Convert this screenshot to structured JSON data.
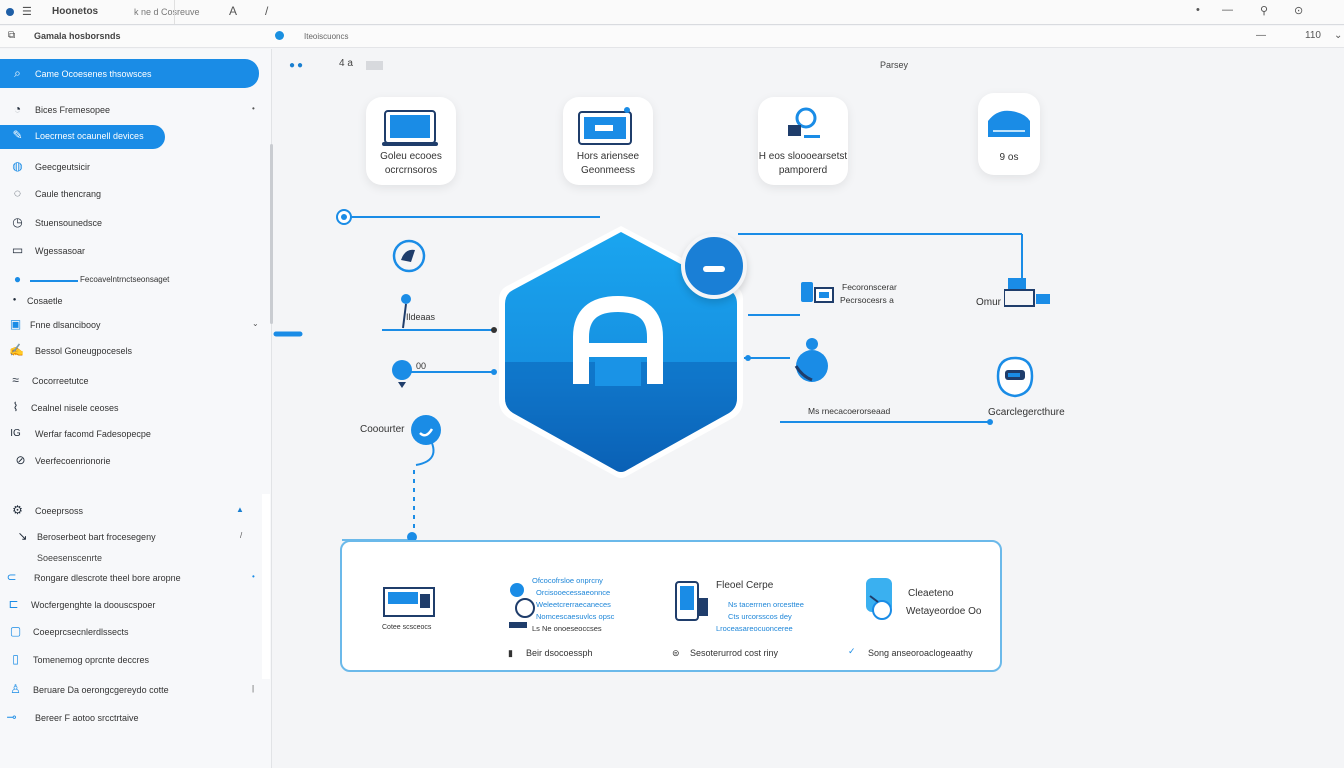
{
  "titlebar": {
    "title": "Hoonetos",
    "subtitle": "k ne d Cosreuve",
    "glyph_a": "A",
    "glyph_pen": "/",
    "buttons": [
      "•",
      "—",
      "⊙"
    ]
  },
  "toolbar": {
    "label": "Gamala hosborsnds",
    "path": "Iteoiscuoncs",
    "controls": [
      "—",
      "110",
      "⌄"
    ]
  },
  "sidebar": {
    "items": [
      {
        "icon": "search-icon",
        "label": "Came Ocoesenes thsowsces",
        "active": true
      },
      {
        "icon": "chat-icon",
        "label": "Bices Fremesopee"
      },
      {
        "icon": "edit-icon",
        "label": "Loecrnest ocaunell devices",
        "active": true
      },
      {
        "icon": "globe-icon",
        "label": "Geecgeutsicir"
      },
      {
        "icon": "notebook-icon",
        "label": "Caule thencrang"
      },
      {
        "icon": "clock-icon",
        "label": "Stuensounedsce"
      },
      {
        "icon": "chat-icon",
        "label": "Wgessasoar"
      },
      {
        "icon": "pin-icon",
        "label": "Fecoavelntrnctseonsaget"
      },
      {
        "icon": "bullet-icon",
        "label": "Cosaetle"
      },
      {
        "icon": "doc-icon",
        "label": "Fnne dlsancibooy"
      },
      {
        "icon": "edit-icon",
        "label": "Bessol Goneugpocesels"
      },
      {
        "icon": "wifi-icon",
        "label": "Cocorreetutce"
      },
      {
        "icon": "pen-icon",
        "label": "Cealnel nisele ceoses"
      },
      {
        "icon": "ip-icon",
        "label": "Werfar facomd Fadesopecpe"
      },
      {
        "icon": "tools-icon",
        "label": "Veerfecoenrionorie"
      },
      {
        "icon": "gear-icon",
        "label": "Coeeprsoss"
      },
      {
        "icon": "arrow-icon",
        "label": "Beroserbeot bart frocesegeny"
      },
      {
        "icon": "none",
        "label": "Soeesenscenrte"
      },
      {
        "icon": "link-icon",
        "label": "Rongare dlescrote theel bore aropne"
      },
      {
        "icon": "folder-icon",
        "label": "Wocfergenghte la doouscspoer"
      },
      {
        "icon": "box-icon",
        "label": "Coeeprcsecnlerdlssects"
      },
      {
        "icon": "tag-icon",
        "label": "Tomenemog oprcnte deccres"
      },
      {
        "icon": "user-icon",
        "label": "Beruare Da oerongcgereydo cotte"
      },
      {
        "icon": "link-icon",
        "label": "Bereer F aotoo srcctrtaive"
      }
    ]
  },
  "main": {
    "header": {
      "tabs": "4 a",
      "right": "Parsey"
    },
    "cards": [
      {
        "line1": "Goleu ecooes",
        "line2": "ocrcrnsoros"
      },
      {
        "line1": "Hors ariensee",
        "line2": "Geonmeess"
      },
      {
        "line1": "H eos sloooearsetst",
        "line2": "pamporerd"
      },
      {
        "line1": "9 os",
        "line2": ""
      }
    ],
    "labels": {
      "left_mid": "Ildeaas",
      "left_dd": "00",
      "left_low": "Cooourter",
      "right_1a": "Fecoronscerar",
      "right_1b": "Pecrsocesrs a",
      "right_1c": "Omur",
      "right_2": "Ms rnecacoerorseaad",
      "right_2b": "Gcarclegercthure"
    },
    "panel": {
      "item1_caption": "Cotee scsceocs",
      "item2_lines": [
        "Ofcocofrsloe onprcny",
        "Orcisooecessaeonnce",
        "Weleetcrerraecaneces",
        "Nomcescaesuvlcs opsc",
        "Ls Ne onoeseoccses"
      ],
      "item3_title": "Fleoel Cerpe",
      "item3_lines": [
        "Ns tacerrnen orcesttee",
        "Cts urcorsscos dey",
        "Lroceasareocuonceree"
      ],
      "item4_title": "Cleaeteno",
      "item4_sub": "Wetayeordoe Oo",
      "foot1": "Beir dsocoessph",
      "foot2": "Sesoterurrod cost riny",
      "foot3": "Song anseoroaclogeaathy"
    }
  },
  "colors": {
    "accent": "#1a8ce6",
    "accent_dark": "#0a5fb0",
    "panel_border": "#6bb9ea"
  }
}
